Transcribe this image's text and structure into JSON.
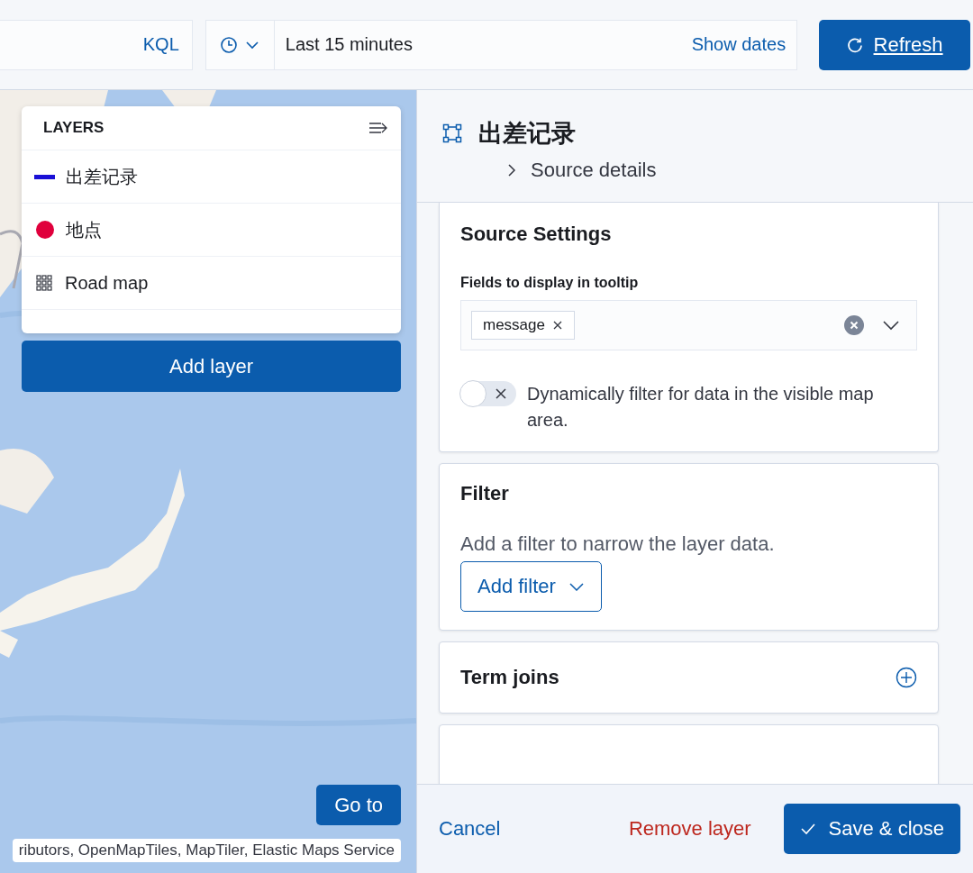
{
  "query_bar": {
    "language": "KQL"
  },
  "date_picker": {
    "range": "Last 15 minutes",
    "toggle": "Show dates"
  },
  "refresh_button": "Refresh",
  "layers_panel": {
    "title": "LAYERS",
    "layers": [
      {
        "name": "出差记录",
        "kind": "line",
        "color": "#1a10d6"
      },
      {
        "name": "地点",
        "kind": "point",
        "color": "#e0003c"
      },
      {
        "name": "Road map",
        "kind": "tiles"
      }
    ],
    "add_button": "Add layer"
  },
  "map": {
    "goto_button": "Go to",
    "attribution": "ributors, OpenMapTiles, MapTiler, Elastic Maps Service"
  },
  "editor": {
    "title": "出差记录",
    "details": {
      "label": "Source details",
      "expanded": false
    },
    "source_settings": {
      "title": "Source Settings",
      "field_label": "Fields to display in tooltip",
      "tags": [
        "message"
      ],
      "switch": {
        "label": "Dynamically filter for data in the visible map area.",
        "on": false
      }
    },
    "filter": {
      "title": "Filter",
      "text": "Add a filter to narrow the layer data.",
      "button": "Add filter"
    },
    "term_joins": {
      "title": "Term joins"
    }
  },
  "footer": {
    "cancel": "Cancel",
    "remove": "Remove layer",
    "save": "Save & close"
  }
}
